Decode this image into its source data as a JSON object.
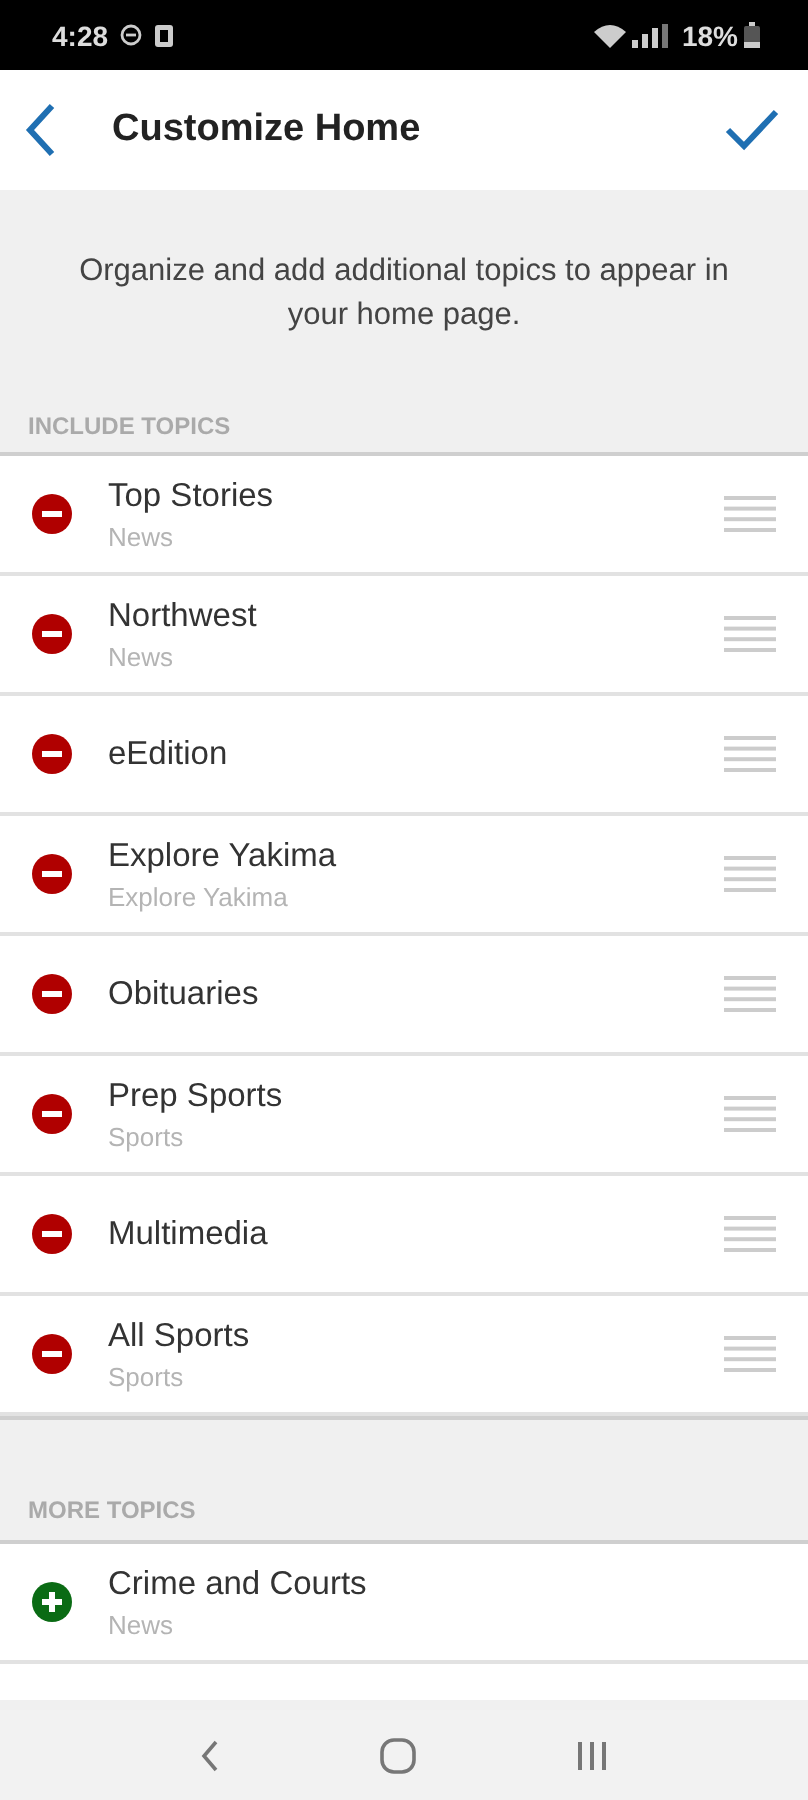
{
  "status_bar": {
    "time": "4:28",
    "battery": "18%"
  },
  "header": {
    "title": "Customize Home"
  },
  "intro": "Organize and add additional topics to appear in your home page.",
  "sections": [
    {
      "heading": "INCLUDE TOPICS",
      "items": [
        {
          "kind": "remove",
          "title": "Top Stories",
          "subtitle": "News"
        },
        {
          "kind": "remove",
          "title": "Northwest",
          "subtitle": "News"
        },
        {
          "kind": "remove",
          "title": "eEdition"
        },
        {
          "kind": "remove",
          "title": "Explore Yakima",
          "subtitle": "Explore Yakima"
        },
        {
          "kind": "remove",
          "title": "Obituaries"
        },
        {
          "kind": "remove",
          "title": "Prep Sports",
          "subtitle": "Sports"
        },
        {
          "kind": "remove",
          "title": "Multimedia"
        },
        {
          "kind": "remove",
          "title": "All Sports",
          "subtitle": "Sports"
        }
      ]
    },
    {
      "heading": "MORE TOPICS",
      "items": [
        {
          "kind": "add",
          "title": "Crime and Courts",
          "subtitle": "News"
        }
      ]
    }
  ]
}
